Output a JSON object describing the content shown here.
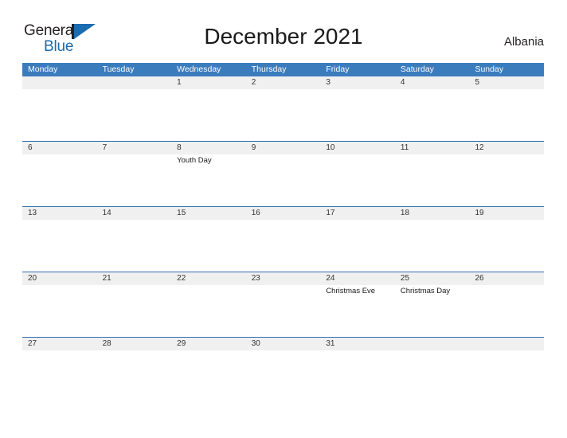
{
  "brand": {
    "name_part1": "General",
    "name_part2": "Blue",
    "flag_color": "#1a6bb0",
    "bar_color": "#231f20"
  },
  "header": {
    "title": "December 2021",
    "region": "Albania"
  },
  "theme": {
    "header_blue": "#3b7cbd",
    "rule_blue": "#2f6fae",
    "band_gray": "#f0f0f0"
  },
  "calendar": {
    "weekdays": [
      "Monday",
      "Tuesday",
      "Wednesday",
      "Thursday",
      "Friday",
      "Saturday",
      "Sunday"
    ],
    "weeks": [
      {
        "days": [
          {
            "date": "",
            "event": ""
          },
          {
            "date": "",
            "event": ""
          },
          {
            "date": "1",
            "event": ""
          },
          {
            "date": "2",
            "event": ""
          },
          {
            "date": "3",
            "event": ""
          },
          {
            "date": "4",
            "event": ""
          },
          {
            "date": "5",
            "event": ""
          }
        ]
      },
      {
        "days": [
          {
            "date": "6",
            "event": ""
          },
          {
            "date": "7",
            "event": ""
          },
          {
            "date": "8",
            "event": "Youth Day"
          },
          {
            "date": "9",
            "event": ""
          },
          {
            "date": "10",
            "event": ""
          },
          {
            "date": "11",
            "event": ""
          },
          {
            "date": "12",
            "event": ""
          }
        ]
      },
      {
        "days": [
          {
            "date": "13",
            "event": ""
          },
          {
            "date": "14",
            "event": ""
          },
          {
            "date": "15",
            "event": ""
          },
          {
            "date": "16",
            "event": ""
          },
          {
            "date": "17",
            "event": ""
          },
          {
            "date": "18",
            "event": ""
          },
          {
            "date": "19",
            "event": ""
          }
        ]
      },
      {
        "days": [
          {
            "date": "20",
            "event": ""
          },
          {
            "date": "21",
            "event": ""
          },
          {
            "date": "22",
            "event": ""
          },
          {
            "date": "23",
            "event": ""
          },
          {
            "date": "24",
            "event": "Christmas Eve"
          },
          {
            "date": "25",
            "event": "Christmas Day"
          },
          {
            "date": "26",
            "event": ""
          }
        ]
      },
      {
        "days": [
          {
            "date": "27",
            "event": ""
          },
          {
            "date": "28",
            "event": ""
          },
          {
            "date": "29",
            "event": ""
          },
          {
            "date": "30",
            "event": ""
          },
          {
            "date": "31",
            "event": ""
          },
          {
            "date": "",
            "event": ""
          },
          {
            "date": "",
            "event": ""
          }
        ]
      }
    ]
  }
}
